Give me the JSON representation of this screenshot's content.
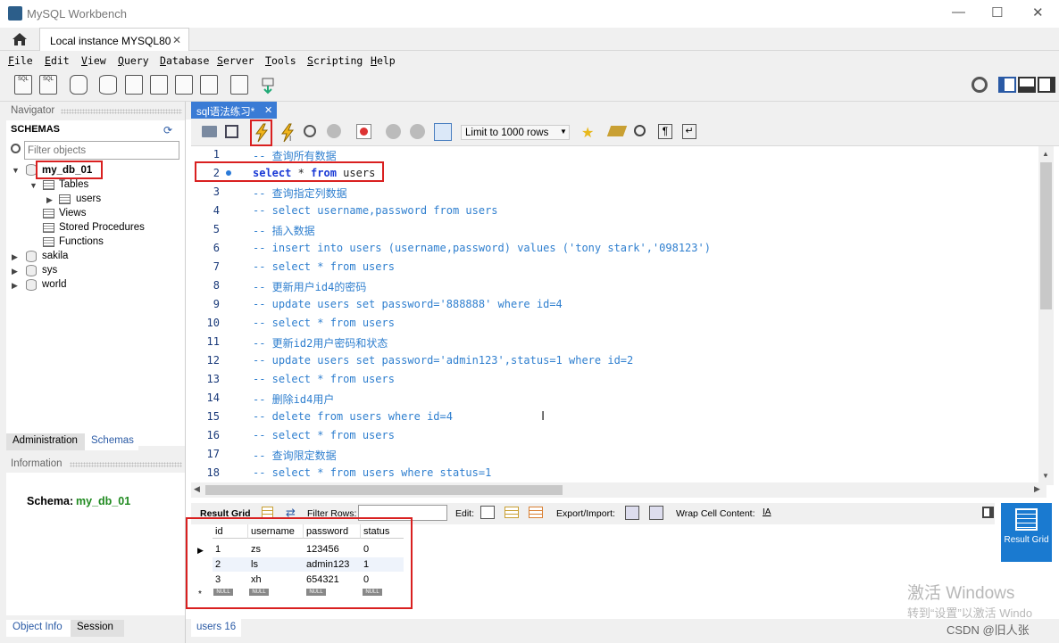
{
  "window": {
    "title": "MySQL Workbench",
    "minimize": "—",
    "maximize": "☐",
    "close": "✕"
  },
  "tabs": {
    "home_icon": "home-icon",
    "instance_tab": "Local instance MYSQL80",
    "close": "✕"
  },
  "menu": [
    "File",
    "Edit",
    "View",
    "Query",
    "Database",
    "Server",
    "Tools",
    "Scripting",
    "Help"
  ],
  "toolbar_labels": {
    "sql1": "SQL",
    "sql2": "SQL"
  },
  "navigator": {
    "title": "Navigator",
    "schemas_title": "SCHEMAS",
    "filter_placeholder": "Filter objects",
    "db_selected": "my_db_01",
    "tables": "Tables",
    "users": "users",
    "views": "Views",
    "stored_procedures": "Stored Procedures",
    "functions": "Functions",
    "other_dbs": [
      "sakila",
      "sys",
      "world"
    ],
    "tab_admin": "Administration",
    "tab_schemas": "Schemas",
    "information": "Information",
    "schema_label": "Schema:",
    "schema_value": "my_db_01",
    "tab_object_info": "Object Info",
    "tab_session": "Session"
  },
  "editor": {
    "tab_label": "sql语法练习*",
    "limit": "Limit to 1000 rows",
    "lines": [
      {
        "n": "1",
        "text": "-- 查询所有数据"
      },
      {
        "n": "2",
        "text": "select * from users",
        "active": true
      },
      {
        "n": "3",
        "text": "-- 查询指定列数据"
      },
      {
        "n": "4",
        "text": "-- select username,password from users"
      },
      {
        "n": "5",
        "text": "-- 插入数据"
      },
      {
        "n": "6",
        "text": "-- insert into users (username,password) values ('tony stark','098123')"
      },
      {
        "n": "7",
        "text": "-- select * from users"
      },
      {
        "n": "8",
        "text": "-- 更新用户id4的密码"
      },
      {
        "n": "9",
        "text": "-- update users set password='888888' where id=4"
      },
      {
        "n": "10",
        "text": "-- select * from users"
      },
      {
        "n": "11",
        "text": "-- 更新id2用户密码和状态"
      },
      {
        "n": "12",
        "text": "-- update users set password='admin123',status=1 where id=2"
      },
      {
        "n": "13",
        "text": "-- select * from users"
      },
      {
        "n": "14",
        "text": "-- 删除id4用户"
      },
      {
        "n": "15",
        "text": "-- delete from users where id=4"
      },
      {
        "n": "16",
        "text": "-- select * from users"
      },
      {
        "n": "17",
        "text": "-- 查询限定数据"
      },
      {
        "n": "18",
        "text": "-- select * from users where status=1"
      }
    ],
    "line2_kw1": "select",
    "line2_mid": " * ",
    "line2_kw2": "from",
    "line2_tail": " users"
  },
  "results": {
    "result_grid": "Result Grid",
    "filter_rows": "Filter Rows:",
    "edit": "Edit:",
    "export_import": "Export/Import:",
    "wrap": "Wrap Cell Content:",
    "side_button": "Result Grid",
    "columns": [
      "id",
      "username",
      "password",
      "status"
    ],
    "rows": [
      [
        "1",
        "zs",
        "123456",
        "0"
      ],
      [
        "2",
        "ls",
        "admin123",
        "1"
      ],
      [
        "3",
        "xh",
        "654321",
        "0"
      ]
    ],
    "null": "NULL",
    "new_row_marker": "*",
    "bottom_tab": "users 16"
  },
  "watermark": {
    "line1": "激活 Windows",
    "line2": "转到“设置”以激活 Windo",
    "csdn": "CSDN @旧人张"
  }
}
